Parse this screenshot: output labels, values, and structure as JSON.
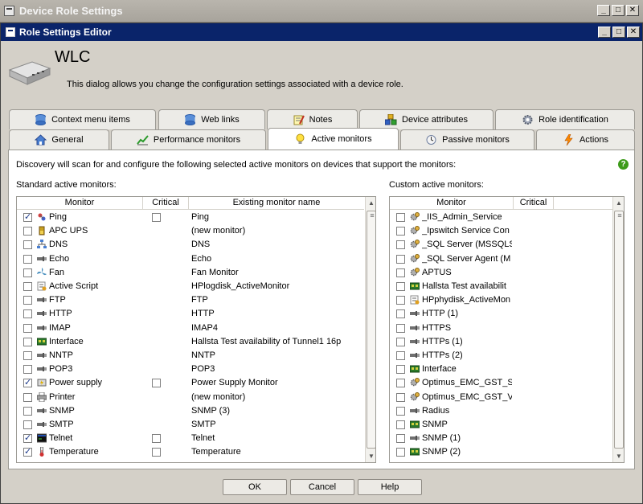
{
  "outer_window": {
    "title": "Device Role Settings"
  },
  "inner_window": {
    "title": "Role Settings Editor"
  },
  "header": {
    "device_name": "WLC",
    "description": "This dialog allows you change the configuration settings associated with a device role."
  },
  "tabs_row1": [
    {
      "label": "Context menu items",
      "icon": "database-icon"
    },
    {
      "label": "Web links",
      "icon": "database-icon"
    },
    {
      "label": "Notes",
      "icon": "notes-icon"
    },
    {
      "label": "Device attributes",
      "icon": "blocks-icon"
    },
    {
      "label": "Role identification",
      "icon": "gear-icon"
    }
  ],
  "tabs_row2": [
    {
      "label": "General",
      "icon": "home-icon"
    },
    {
      "label": "Performance monitors",
      "icon": "chart-icon"
    },
    {
      "label": "Active monitors",
      "icon": "lightbulb-icon",
      "active": true
    },
    {
      "label": "Passive monitors",
      "icon": "clock-icon"
    },
    {
      "label": "Actions",
      "icon": "lightning-icon"
    }
  ],
  "panel": {
    "discovery_text": "Discovery will scan for and configure the following selected active monitors on devices that support the monitors:",
    "help_glyph": "?"
  },
  "standard": {
    "label": "Standard active monitors:",
    "columns": [
      "Monitor",
      "Critical",
      "Existing monitor name"
    ],
    "rows": [
      {
        "monitor": "Ping",
        "checked": true,
        "critical_box": true,
        "existing": "Ping",
        "icon": "ping-icon"
      },
      {
        "monitor": "APC UPS",
        "checked": false,
        "critical_box": false,
        "existing": "(new monitor)",
        "icon": "battery-icon"
      },
      {
        "monitor": "DNS",
        "checked": false,
        "critical_box": false,
        "existing": "DNS",
        "icon": "network-icon"
      },
      {
        "monitor": "Echo",
        "checked": false,
        "critical_box": false,
        "existing": "Echo",
        "icon": "plug-icon"
      },
      {
        "monitor": "Fan",
        "checked": false,
        "critical_box": false,
        "existing": "Fan Monitor",
        "icon": "fan-icon"
      },
      {
        "monitor": "Active Script",
        "checked": false,
        "critical_box": false,
        "existing": "HPlogdisk_ActiveMonitor",
        "icon": "script-icon"
      },
      {
        "monitor": "FTP",
        "checked": false,
        "critical_box": false,
        "existing": "FTP",
        "icon": "plug-icon"
      },
      {
        "monitor": "HTTP",
        "checked": false,
        "critical_box": false,
        "existing": "HTTP",
        "icon": "plug-icon"
      },
      {
        "monitor": "IMAP",
        "checked": false,
        "critical_box": false,
        "existing": "IMAP4",
        "icon": "plug-icon"
      },
      {
        "monitor": "Interface",
        "checked": false,
        "critical_box": false,
        "existing": "Hallsta Test availability of Tunnel1 16p",
        "icon": "nic-icon"
      },
      {
        "monitor": "NNTP",
        "checked": false,
        "critical_box": false,
        "existing": "NNTP",
        "icon": "plug-icon"
      },
      {
        "monitor": "POP3",
        "checked": false,
        "critical_box": false,
        "existing": "POP3",
        "icon": "plug-icon"
      },
      {
        "monitor": "Power supply",
        "checked": true,
        "critical_box": true,
        "existing": "Power Supply Monitor",
        "icon": "power-icon"
      },
      {
        "monitor": "Printer",
        "checked": false,
        "critical_box": false,
        "existing": "(new monitor)",
        "icon": "printer-icon"
      },
      {
        "monitor": "SNMP",
        "checked": false,
        "critical_box": false,
        "existing": "SNMP (3)",
        "icon": "plug-icon"
      },
      {
        "monitor": "SMTP",
        "checked": false,
        "critical_box": false,
        "existing": "SMTP",
        "icon": "plug-icon"
      },
      {
        "monitor": "Telnet",
        "checked": true,
        "critical_box": true,
        "existing": "Telnet",
        "icon": "terminal-icon"
      },
      {
        "monitor": "Temperature",
        "checked": true,
        "critical_box": true,
        "existing": "Temperature",
        "icon": "thermometer-icon"
      }
    ]
  },
  "custom": {
    "label": "Custom active monitors:",
    "columns": [
      "Monitor",
      "Critical"
    ],
    "rows": [
      {
        "monitor": "_IIS_Admin_Service",
        "icon": "service-icon"
      },
      {
        "monitor": "_Ipswitch Service Con",
        "icon": "service-icon"
      },
      {
        "monitor": "_SQL Server (MSSQLS",
        "icon": "service-icon"
      },
      {
        "monitor": "_SQL Server Agent (M",
        "icon": "service-icon"
      },
      {
        "monitor": "APTUS",
        "icon": "service-icon"
      },
      {
        "monitor": "Hallsta Test availabilit",
        "icon": "nic-icon"
      },
      {
        "monitor": "HPphydisk_ActiveMon",
        "icon": "script-icon"
      },
      {
        "monitor": "HTTP (1)",
        "icon": "plug-icon"
      },
      {
        "monitor": "HTTPS",
        "icon": "plug-icon"
      },
      {
        "monitor": "HTTPs (1)",
        "icon": "plug-icon"
      },
      {
        "monitor": "HTTPs (2)",
        "icon": "plug-icon"
      },
      {
        "monitor": "Interface",
        "icon": "nic-icon"
      },
      {
        "monitor": "Optimus_EMC_GST_S",
        "icon": "service-icon"
      },
      {
        "monitor": "Optimus_EMC_GST_V",
        "icon": "service-icon"
      },
      {
        "monitor": "Radius",
        "icon": "plug-icon"
      },
      {
        "monitor": "SNMP",
        "icon": "nic-icon"
      },
      {
        "monitor": "SNMP (1)",
        "icon": "plug-icon"
      },
      {
        "monitor": "SNMP (2)",
        "icon": "nic-icon"
      }
    ]
  },
  "buttons": {
    "ok": "OK",
    "cancel": "Cancel",
    "help": "Help"
  },
  "window_controls": {
    "minimize": "_",
    "maximize": "□",
    "close": "✕"
  },
  "colors": {
    "inner_title_bar": "#0a246a",
    "dialog_bg": "#d4d0c8",
    "check": "#1c3a8a",
    "help_green": "#3d9b1a"
  }
}
